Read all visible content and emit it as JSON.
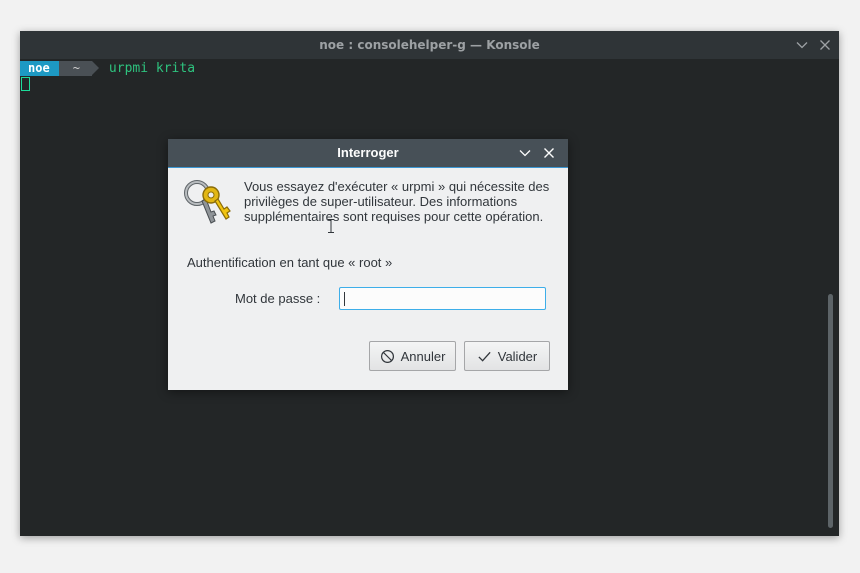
{
  "konsole": {
    "title": "noe : consolehelper-g — Konsole",
    "prompt_user": "noe",
    "prompt_dir": "~",
    "command": "urpmi krita"
  },
  "dialog": {
    "title": "Interroger",
    "message": "Vous essayez d'exécuter « urpmi » qui nécessite des privilèges de super-utilisateur. Des informations supplémentaires sont requises pour cette opération.",
    "auth_line": "Authentification en tant que « root »",
    "password_label": "Mot de passe :",
    "password_value": "",
    "cancel_label": "Annuler",
    "ok_label": "Valider"
  },
  "icons": {
    "titlebar_minimize": "chevron-down-icon",
    "titlebar_close": "close-icon",
    "dialog_image": "keys-icon",
    "cancel": "cancel-icon",
    "ok": "checkmark-icon"
  },
  "colors": {
    "accent": "#3daee9",
    "prompt_user_bg": "#1d99c3",
    "prompt_dir_bg": "#4a5055",
    "command_text": "#2ec27e",
    "terminal_bg": "#232627"
  }
}
